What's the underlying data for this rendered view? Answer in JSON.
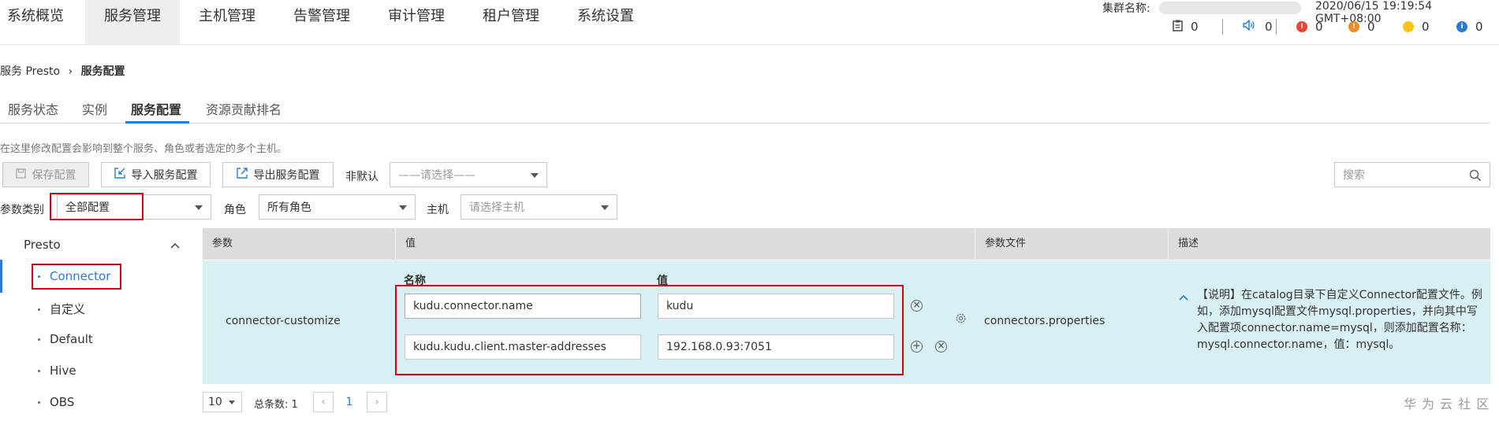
{
  "nav": {
    "items": [
      "系统概览",
      "服务管理",
      "主机管理",
      "告警管理",
      "审计管理",
      "租户管理",
      "系统设置"
    ],
    "active_index": 1
  },
  "header": {
    "cluster_label": "集群名称:",
    "datetime": "2020/06/15 19:19:54 GMT+08:00",
    "stats": {
      "tasks": "0",
      "audio": "0",
      "critical": "0",
      "major": "0",
      "minor": "0",
      "info": "0"
    },
    "colors": {
      "critical": "#e8443a",
      "major": "#f08a24",
      "minor": "#f5c518",
      "info": "#2d7ad3"
    }
  },
  "breadcrumb": {
    "parent": "服务 Presto",
    "separator": "›",
    "current": "服务配置"
  },
  "tabs": [
    "服务状态",
    "实例",
    "服务配置",
    "资源贡献排名"
  ],
  "active_tab": "服务配置",
  "hint": "在这里修改配置会影响到整个服务、角色或者选定的多个主机。",
  "toolbar": {
    "save_label": "保存配置",
    "import_label": "导入服务配置",
    "export_label": "导出服务配置",
    "nondefault_label": "非默认",
    "nondefault_placeholder": "——请选择——",
    "search_placeholder": "搜索"
  },
  "filters": {
    "category_label": "参数类别",
    "category_value": "全部配置",
    "role_label": "角色",
    "role_value": "所有角色",
    "host_label": "主机",
    "host_placeholder": "请选择主机"
  },
  "sidebar": {
    "group": "Presto",
    "items": [
      "Connector",
      "自定义",
      "Default",
      "Hive",
      "OBS"
    ],
    "active_item": "Connector"
  },
  "table": {
    "headers": [
      "参数",
      "值",
      "参数文件",
      "描述"
    ],
    "row": {
      "param": "connector-customize",
      "name_header": "名称",
      "value_header": "值",
      "pairs": [
        {
          "name": "kudu.connector.name",
          "value": "kudu"
        },
        {
          "name": "kudu.kudu.client.master-addresses",
          "value": "192.168.0.93:7051"
        }
      ],
      "file": "connectors.properties",
      "description_lines": [
        "【说明】在catalog目录下自定义Connector配置文件。例",
        "如，添加mysql配置文件mysql.properties，并向其中写",
        "入配置项connector.name=mysql，则添加配置名称：",
        "mysql.connector.name，值：mysql。"
      ]
    }
  },
  "pagination": {
    "page_size": "10",
    "total": "总条数: 1",
    "current": "1"
  },
  "watermark": "华 为 云 社 区"
}
